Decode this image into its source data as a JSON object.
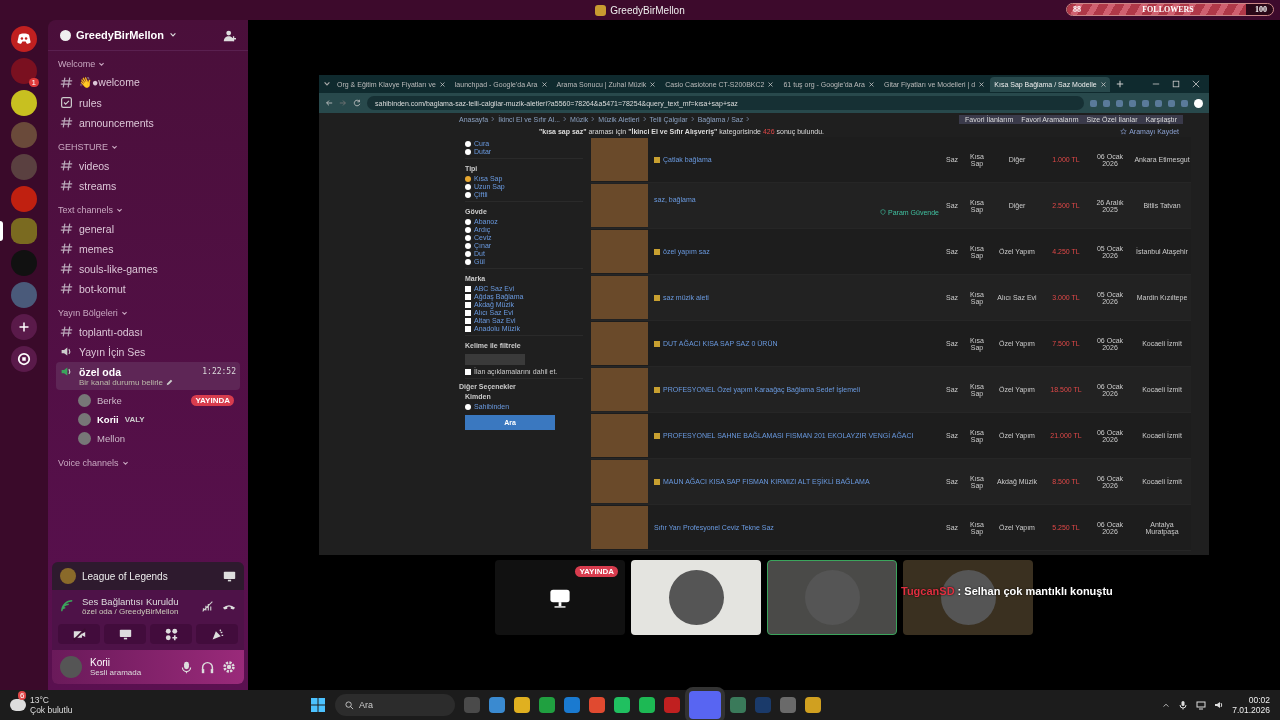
{
  "top_bar": {
    "title": "GreedyBirMellon",
    "followers": {
      "label": "FOLLOWERS",
      "current": "88",
      "goal": "100",
      "level": 0.87
    }
  },
  "servers": [
    {
      "kind": "home",
      "selected": false
    },
    {
      "kind": "server",
      "selected": false,
      "badge": "1"
    },
    {
      "kind": "server",
      "selected": false
    },
    {
      "kind": "server",
      "selected": false
    },
    {
      "kind": "server",
      "selected": false
    },
    {
      "kind": "server",
      "selected": false
    },
    {
      "kind": "server",
      "selected": true
    },
    {
      "kind": "server",
      "selected": false
    },
    {
      "kind": "server",
      "selected": false
    },
    {
      "kind": "add",
      "selected": false
    },
    {
      "kind": "explore",
      "selected": false
    }
  ],
  "server_name": "GreedyBirMellon",
  "categories": [
    {
      "name": "Welcome",
      "channels": [
        {
          "kind": "text",
          "name": "👋●welcome",
          "selected": false
        },
        {
          "kind": "rules",
          "name": "rules",
          "selected": false
        },
        {
          "kind": "text",
          "name": "announcements",
          "selected": false
        }
      ]
    },
    {
      "name": "GEHSTURE",
      "channels": [
        {
          "kind": "text",
          "name": "videos",
          "selected": false
        },
        {
          "kind": "text",
          "name": "streams",
          "selected": false
        }
      ]
    },
    {
      "name": "Text channels",
      "channels": [
        {
          "kind": "text",
          "name": "general",
          "selected": false
        },
        {
          "kind": "text",
          "name": "memes",
          "selected": false
        },
        {
          "kind": "text",
          "name": "souls-like-games",
          "selected": false
        },
        {
          "kind": "text",
          "name": "bot-komut",
          "selected": false
        }
      ]
    },
    {
      "name": "Yayın Bölgeleri",
      "channels": [
        {
          "kind": "stage",
          "name": "toplantı-odası",
          "selected": false
        },
        {
          "kind": "voice",
          "name": "Yayın İçin Ses",
          "selected": false
        },
        {
          "kind": "voice",
          "name": "özel oda",
          "selected": true,
          "time": "1:22:52",
          "status": "Bir kanal durumu belirle",
          "members": [
            {
              "name": "Berke",
              "bold": false,
              "live": "YAYINDA"
            },
            {
              "name": "Korii",
              "bold": true,
              "tag": "VALY"
            },
            {
              "name": "Mellon",
              "bold": false
            }
          ]
        }
      ]
    },
    {
      "name": "Voice channels"
    }
  ],
  "activity": {
    "game": "League of Legends"
  },
  "voice_panel": {
    "status": "Ses Bağlantısı Kuruldu",
    "channel": "özel oda / GreedyBirMellon"
  },
  "user_panel": {
    "name": "Korii",
    "status": "Sesli aramada"
  },
  "browser": {
    "tabs": [
      {
        "label": "Org & Eğitim Klavye Fiyatları ve",
        "selected": false
      },
      {
        "label": "launchpad - Google'da Ara",
        "selected": false
      },
      {
        "label": "Arama Sonucu | Zuhal Müzik",
        "selected": false
      },
      {
        "label": "Casio Casiotone CT-S200BKC2",
        "selected": false
      },
      {
        "label": "61 tuş org - Google'da Ara",
        "selected": false
      },
      {
        "label": "Gitar Fiyatları ve Modelleri | d",
        "selected": false
      },
      {
        "label": "Kısa Sap Bağlama / Saz Modelle",
        "selected": true
      }
    ],
    "url": "sahibinden.com/baglama-saz-telli-calgilar-muzik-aletleri?a5560=78264&a5471=78254&query_text_mf=kısa+sap+saz",
    "breadcrumbs": [
      "Anasayfa",
      "İkinci El ve Sıfır Al...",
      "Müzik",
      "Müzik Aletleri",
      "Telli Çalgılar",
      "Bağlama / Saz"
    ],
    "top_links": [
      "Favori İlanlarım",
      "Favori Aramalarım",
      "Size Özel İlanlar",
      "Karşılaştır"
    ],
    "result": {
      "before": "**\"kısa sap saz\"** araması için **\"İkinci El ve Sıfır Alışveriş\"** kategorisinde",
      "count": "426",
      "after": "sonuç bulundu."
    },
    "save_search": "Aramayı Kaydet",
    "filters": [
      {
        "kind": "radio",
        "options": [
          {
            "label": "Cura",
            "checked": false
          },
          {
            "label": "Dutar",
            "checked": false
          }
        ]
      },
      {
        "kind": "radio",
        "title": "Tipi",
        "options": [
          {
            "label": "Kısa Sap",
            "checked": true
          },
          {
            "label": "Uzun Sap",
            "checked": false
          },
          {
            "label": "Çiftli",
            "checked": false
          }
        ]
      },
      {
        "kind": "radio",
        "title": "Gövde",
        "options": [
          {
            "label": "Abanoz",
            "checked": false
          },
          {
            "label": "Ardıç",
            "checked": false
          },
          {
            "label": "Ceviz",
            "checked": false
          },
          {
            "label": "Çınar",
            "checked": false
          },
          {
            "label": "Dut",
            "checked": false
          },
          {
            "label": "Gül",
            "checked": false
          }
        ]
      },
      {
        "kind": "checkbox",
        "title": "Marka",
        "options": [
          {
            "label": "ABC Saz Evi",
            "checked": false
          },
          {
            "label": "Ağdaş Bağlama",
            "checked": false
          },
          {
            "label": "Akdağ Müzik",
            "checked": false
          },
          {
            "label": "Alıcı Saz Evi",
            "checked": false
          },
          {
            "label": "Altan Saz Evi",
            "checked": false
          },
          {
            "label": "Anadolu Müzik",
            "checked": false
          }
        ]
      },
      {
        "kind": "keyword",
        "title": "Kelime ile filtrele",
        "options": [
          {
            "label": "İlan açıklamalarını dahil et.",
            "checked": false
          }
        ]
      }
    ],
    "other_options": "Diğer Seçenekler",
    "from_title": "Kimden",
    "from_options": [
      {
        "label": "Sahibinden",
        "checked": false
      }
    ],
    "search_button": "Ara",
    "listings": [
      {
        "title": "Çatlak bağlama",
        "featured": true,
        "type": "Saz",
        "neck": "Kısa Sap",
        "brand": "Diğer",
        "price": "1.000 TL",
        "date": "06 Ocak 2026",
        "location": "Ankara Etimesgut"
      },
      {
        "title": "saz, bağlama",
        "featured": false,
        "safe": "Param Güvende",
        "type": "Saz",
        "neck": "Kısa Sap",
        "brand": "Diğer",
        "price": "2.500 TL",
        "date": "26 Aralık 2025",
        "location": "Bitlis Tatvan"
      },
      {
        "title": "özel yapım saz",
        "featured": true,
        "type": "Saz",
        "neck": "Kısa Sap",
        "brand": "Özel Yapım",
        "price": "4.250 TL",
        "date": "05 Ocak 2026",
        "location": "İstanbul Ataşehir"
      },
      {
        "title": "saz müzik aleti",
        "featured": true,
        "type": "Saz",
        "neck": "Kısa Sap",
        "brand": "Alıcı Saz Evi",
        "price": "3.000 TL",
        "date": "05 Ocak 2026",
        "location": "Mardin Kızıltepe"
      },
      {
        "title": "DUT AĞACI KISA SAP SAZ 0 ÜRÜN",
        "featured": true,
        "type": "Saz",
        "neck": "Kısa Sap",
        "brand": "Özel Yapım",
        "price": "7.500 TL",
        "date": "06 Ocak 2026",
        "location": "Kocaeli İzmit"
      },
      {
        "title": "PROFESYONEL Özel yapım Karaağaç Bağlama Sedef İşlemeli",
        "featured": true,
        "type": "Saz",
        "neck": "Kısa Sap",
        "brand": "Özel Yapım",
        "price": "18.500 TL",
        "date": "06 Ocak 2026",
        "location": "Kocaeli İzmit"
      },
      {
        "title": "PROFESYONEL SAHNE BAĞLAMASI FISMAN 201 EKOLAYZIR VENGİ AĞACI",
        "featured": true,
        "type": "Saz",
        "neck": "Kısa Sap",
        "brand": "Özel Yapım",
        "price": "21.000 TL",
        "date": "06 Ocak 2026",
        "location": "Kocaeli İzmit"
      },
      {
        "title": "MAUN AĞACI KISA SAP FISMAN KIRMIZI ALT EŞİKLİ BAĞLAMA",
        "featured": true,
        "type": "Saz",
        "neck": "Kısa Sap",
        "brand": "Akdağ Müzik",
        "price": "8.500 TL",
        "date": "06 Ocak 2026",
        "location": "Kocaeli İzmit"
      },
      {
        "title": "Sıfır Yarı Profesyonel Ceviz Tekne Saz",
        "featured": false,
        "type": "Saz",
        "neck": "Kısa Sap",
        "brand": "Özel Yapım",
        "price": "5.250 TL",
        "date": "06 Ocak 2026",
        "location": "Antalya Muratpaşa"
      }
    ]
  },
  "tiles": [
    {
      "kind": "screen",
      "selected": false,
      "live": "YAYINDA"
    },
    {
      "kind": "avatar",
      "selected": false
    },
    {
      "kind": "avatar",
      "selected": true
    },
    {
      "kind": "avatar-dark",
      "selected": false
    }
  ],
  "chat_overlay": {
    "user": "TugcanSD",
    "message": ": Selhan çok mantıklı konuştu"
  },
  "taskbar": {
    "weather": {
      "temp": "13°C",
      "desc": "Çok bulutlu",
      "badge": "6"
    },
    "search": "Ara",
    "time": "00:02",
    "date": "7.01.2026"
  }
}
